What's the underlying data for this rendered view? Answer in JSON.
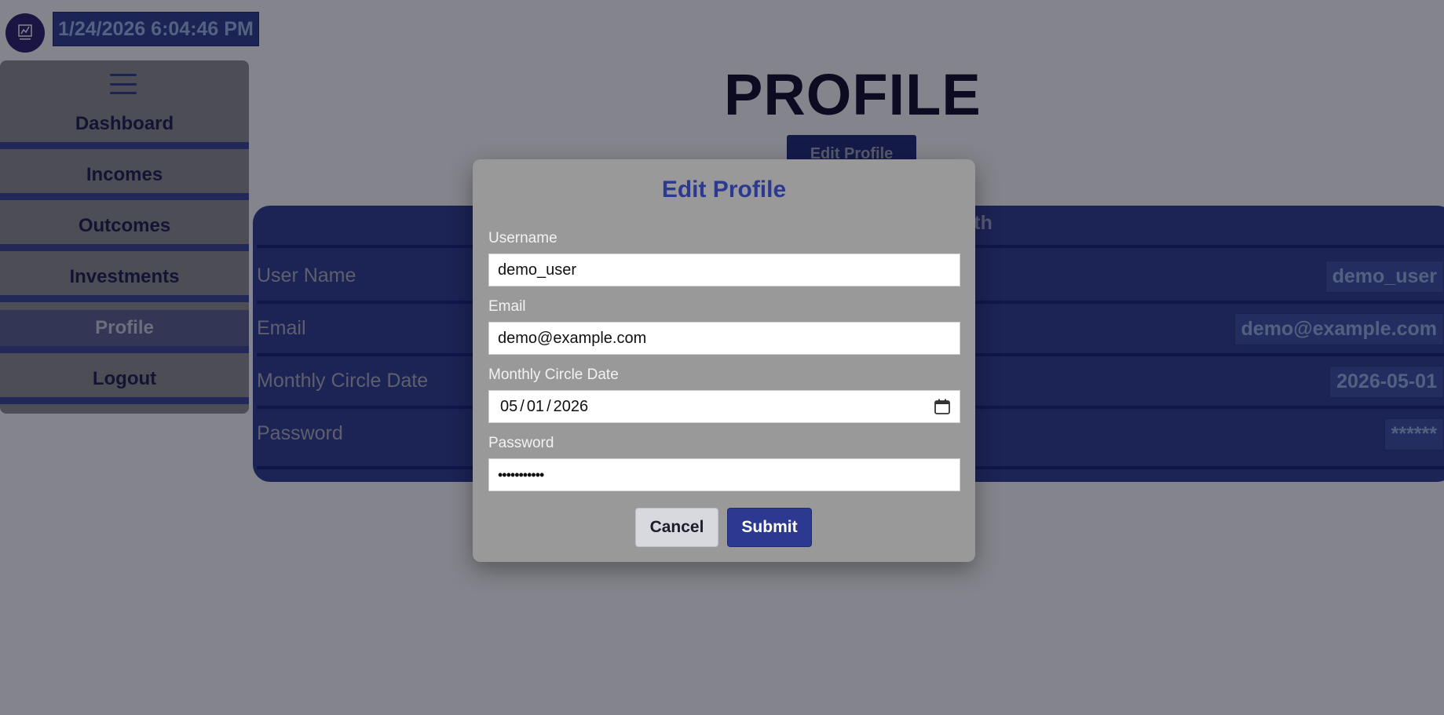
{
  "header": {
    "logo_icon": "app-logo",
    "datetime": "1/24/2026 6:04:46 PM"
  },
  "sidebar": {
    "menu_icon": "hamburger-icon",
    "items": [
      {
        "label": "Dashboard"
      },
      {
        "label": "Incomes"
      },
      {
        "label": "Outcomes"
      },
      {
        "label": "Investments"
      },
      {
        "label": "Profile"
      },
      {
        "label": "Logout"
      }
    ]
  },
  "page": {
    "title": "PROFILE",
    "edit_button": "Edit Profile",
    "card_header_partial": "nth",
    "rows": [
      {
        "label": "User Name",
        "value": "demo_user"
      },
      {
        "label": "Email",
        "value": "demo@example.com"
      },
      {
        "label": "Monthly Circle Date",
        "value": "2026-05-01"
      },
      {
        "label": "Password",
        "value": "******"
      }
    ]
  },
  "modal": {
    "title": "Edit Profile",
    "username_label": "Username",
    "username_value": "demo_user",
    "email_label": "Email",
    "email_value": "demo@example.com",
    "date_label": "Monthly Circle Date",
    "date_month": "05",
    "date_day": "01",
    "date_year": "2026",
    "date_sep": "/",
    "password_label": "Password",
    "password_masked": "•••••••••••",
    "cancel_label": "Cancel",
    "submit_label": "Submit"
  },
  "colors": {
    "accent": "#2b3990",
    "modal_bg": "#999999",
    "overlay": "rgba(10,12,26,0.5)"
  }
}
